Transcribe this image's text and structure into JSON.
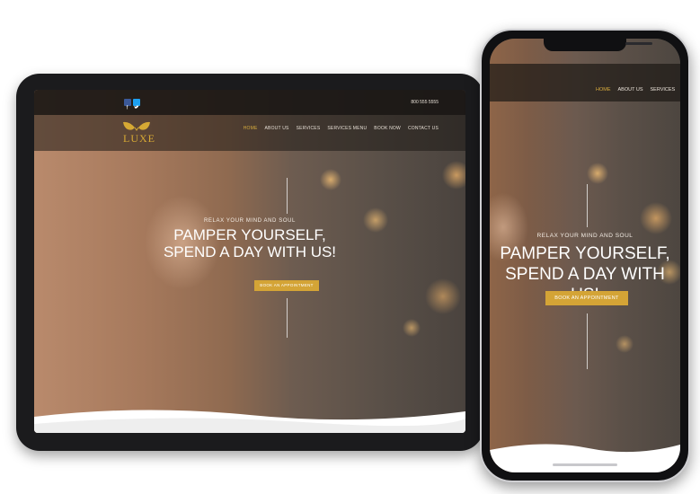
{
  "brand": {
    "logo_text": "LUXE",
    "accent_color": "#d4a436"
  },
  "tablet": {
    "topbar": {
      "phone_number": "800 555 5555",
      "social": [
        {
          "name": "facebook-icon",
          "color": "#3b5998"
        },
        {
          "name": "twitter-icon",
          "color": "#1da1f2"
        }
      ]
    },
    "nav": {
      "items": [
        "HOME",
        "ABOUT US",
        "SERVICES",
        "SERVICES MENU",
        "BOOK NOW",
        "CONTACT US"
      ],
      "active": "HOME"
    },
    "hero": {
      "tagline": "RELAX YOUR MIND AND SOUL",
      "heading_line1": "PAMPER YOURSELF,",
      "heading_line2": "SPEND A DAY WITH US!",
      "cta": "BOOK AN APPOINTMENT"
    }
  },
  "phone": {
    "nav": {
      "items": [
        "HOME",
        "ABOUT US",
        "SERVICES"
      ],
      "active": "HOME"
    },
    "hero": {
      "tagline": "RELAX YOUR MIND AND SOUL",
      "heading_line1": "PAMPER YOURSELF,",
      "heading_line2": "SPEND A DAY WITH US!",
      "cta": "BOOK AN APPOINTMENT"
    }
  }
}
